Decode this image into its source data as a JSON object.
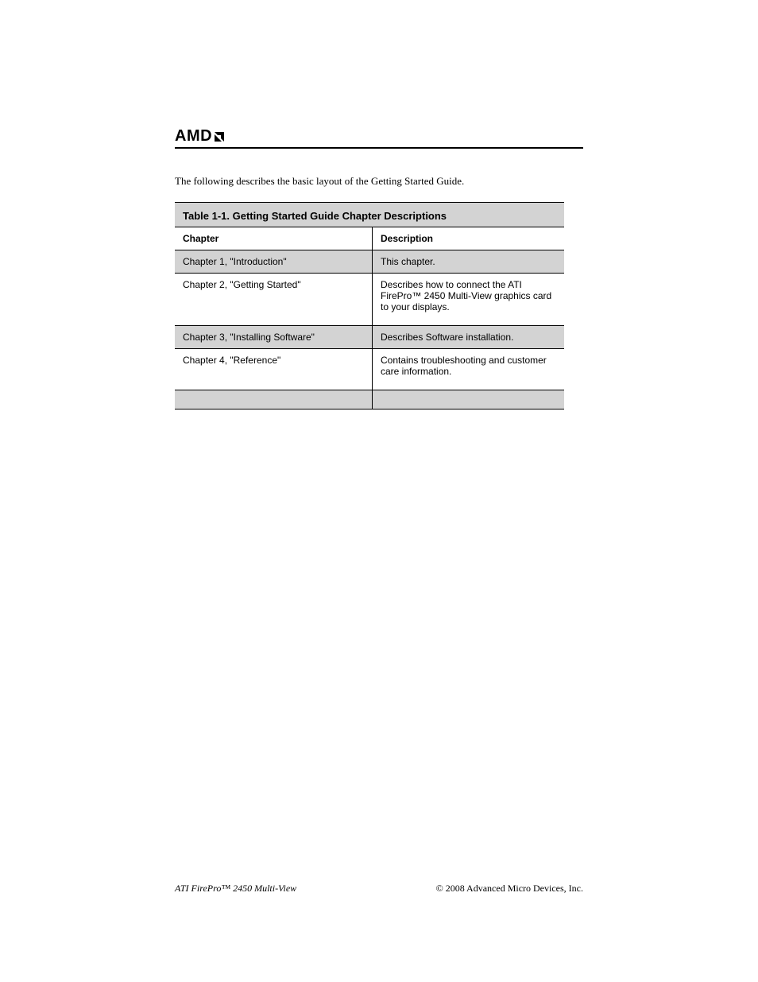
{
  "logo_text": "AMD",
  "intro": "The following describes the basic layout of the Getting Started Guide.",
  "table": {
    "title": "Table 1-1. Getting Started Guide Chapter Descriptions",
    "header": {
      "left": "Chapter",
      "right": "Description"
    },
    "rows": [
      {
        "left": "Chapter 1, \"Introduction\"",
        "right": "This chapter."
      },
      {
        "left": "Chapter 2, \"Getting Started\"",
        "right": "Describes how to connect the ATI FirePro™ 2450 Multi-View graphics card to your displays."
      },
      {
        "left": "Chapter 3, \"Installing Software\"",
        "right": "Describes Software installation."
      },
      {
        "left": "Chapter 4, \"Reference\"",
        "right": "Contains troubleshooting and customer care information."
      }
    ]
  },
  "footer": {
    "left": "ATI FirePro™ 2450 Multi-View",
    "right": "© 2008 Advanced Micro Devices, Inc."
  }
}
